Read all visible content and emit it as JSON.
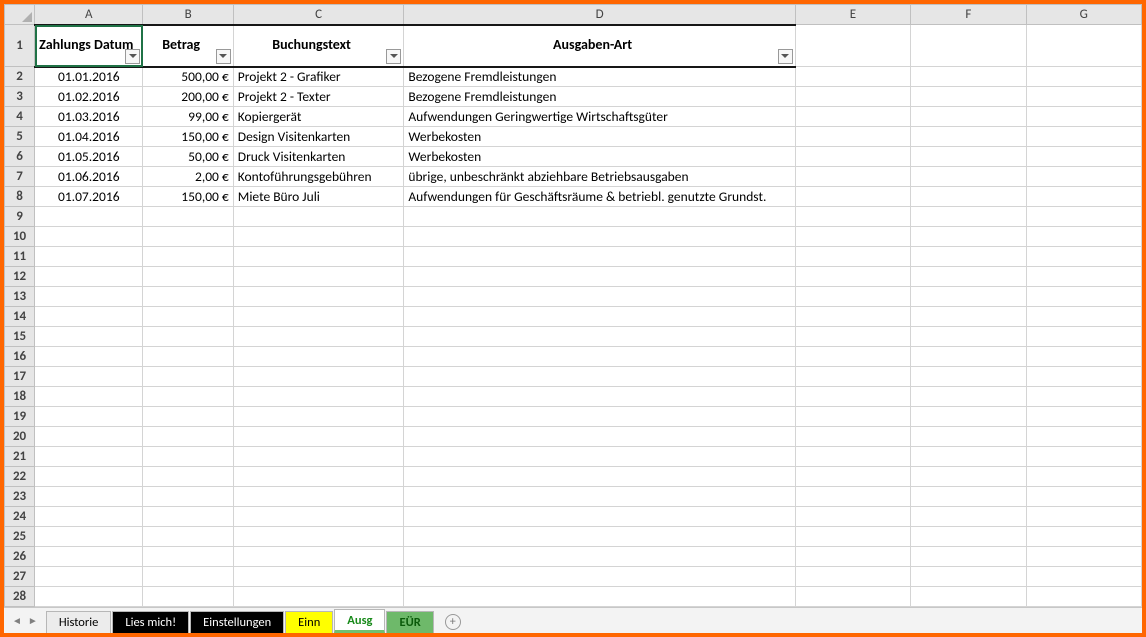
{
  "columns": [
    "A",
    "B",
    "C",
    "D",
    "E",
    "F",
    "G"
  ],
  "header": {
    "A": "Zahlungs Datum",
    "B": "Betrag",
    "C": "Buchungstext",
    "D": "Ausgaben-Art"
  },
  "rows": [
    {
      "n": 2,
      "A": "01.01.2016",
      "B": "500,00 €",
      "C": "Projekt 2 - Grafiker",
      "D": "Bezogene Fremdleistungen"
    },
    {
      "n": 3,
      "A": "01.02.2016",
      "B": "200,00 €",
      "C": "Projekt 2 - Texter",
      "D": "Bezogene Fremdleistungen"
    },
    {
      "n": 4,
      "A": "01.03.2016",
      "B": "99,00 €",
      "C": "Kopiergerät",
      "D": "Aufwendungen Geringwertige Wirtschaftsgüter"
    },
    {
      "n": 5,
      "A": "01.04.2016",
      "B": "150,00 €",
      "C": "Design Visitenkarten",
      "D": "Werbekosten"
    },
    {
      "n": 6,
      "A": "01.05.2016",
      "B": "50,00 €",
      "C": "Druck Visitenkarten",
      "D": "Werbekosten"
    },
    {
      "n": 7,
      "A": "01.06.2016",
      "B": "2,00 €",
      "C": "Kontoführungsgebühren",
      "D": "übrige, unbeschränkt abziehbare Betriebsausgaben"
    },
    {
      "n": 8,
      "A": "01.07.2016",
      "B": "150,00 €",
      "C": "Miete Büro Juli",
      "D": "Aufwendungen für Geschäftsräume & betriebl. genutzte Grundst."
    }
  ],
  "emptyRows": [
    9,
    10,
    11,
    12,
    13,
    14,
    15,
    16,
    17,
    18,
    19,
    20,
    21,
    22,
    23,
    24,
    25,
    26,
    27,
    28
  ],
  "tabs": [
    {
      "label": "Historie",
      "style": "plain"
    },
    {
      "label": "Lies mich!",
      "style": "black"
    },
    {
      "label": "Einstellungen",
      "style": "black"
    },
    {
      "label": "Einn",
      "style": "yellow"
    },
    {
      "label": "Ausg",
      "style": "active"
    },
    {
      "label": "EÜR",
      "style": "eur"
    }
  ]
}
